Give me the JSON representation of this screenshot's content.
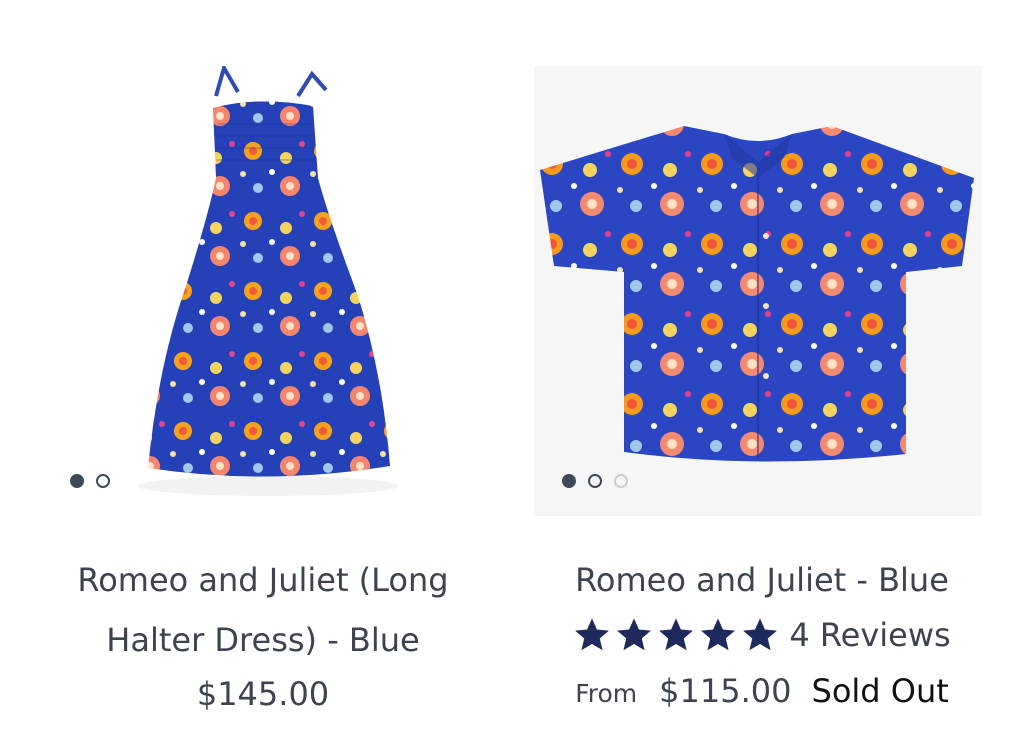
{
  "products": [
    {
      "title": "Romeo and Juliet (Long Halter Dress) - Blue",
      "price": "$145.00",
      "image_count": 2,
      "active_image": 1,
      "image_subject": "dress"
    },
    {
      "title": "Romeo and Juliet - Blue",
      "rating": 5,
      "rating_max": 5,
      "reviews": "4 Reviews",
      "price_prefix": "From",
      "price": "$115.00",
      "status": "Sold Out",
      "image_count": 3,
      "active_image": 1,
      "image_subject": "shirt"
    }
  ],
  "colors": {
    "text": "#3d4450",
    "star": "#1f2a5c",
    "dot": "#3d4a57",
    "fabric_blue": "#2541b8"
  }
}
